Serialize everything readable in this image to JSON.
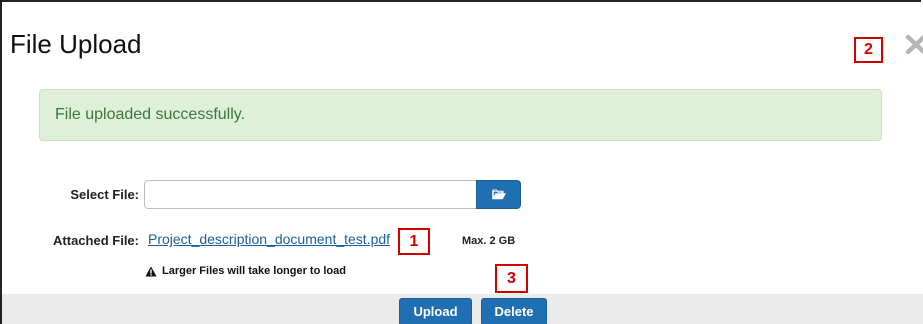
{
  "dialog": {
    "title": "File Upload",
    "close_icon": "close-icon"
  },
  "callouts": {
    "one": "1",
    "two": "2",
    "three": "3"
  },
  "alert": {
    "message": "File uploaded successfully.",
    "background": "#dff0d8",
    "text_color": "#3c763d"
  },
  "form": {
    "select_file_label": "Select File:",
    "select_file_value": "",
    "browse_icon": "folder-open-icon",
    "attached_file_label": "Attached File:",
    "attached_file_name": "Project_description_document_test.pdf",
    "max_size": "Max. 2 GB",
    "warning_icon": "warning-icon",
    "warning_text": "Larger Files will take longer to load"
  },
  "footer": {
    "upload_label": "Upload",
    "delete_label": "Delete"
  },
  "colors": {
    "primary_button": "#1f6fb2",
    "callout_border": "#d40000",
    "link": "#1a5f98"
  }
}
